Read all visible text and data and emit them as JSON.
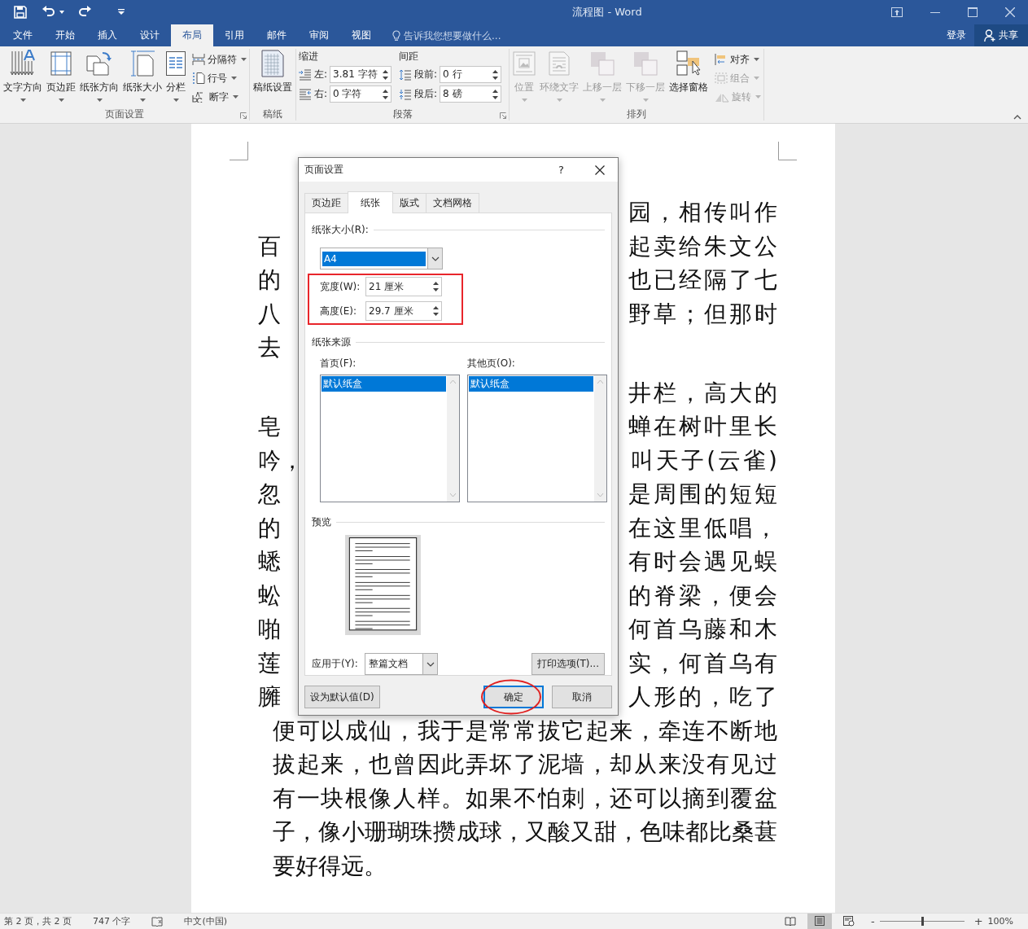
{
  "title_bar": {
    "title": "流程图 - Word"
  },
  "ribbon_tabs": [
    {
      "label": "文件",
      "selected": false
    },
    {
      "label": "开始",
      "selected": false
    },
    {
      "label": "插入",
      "selected": false
    },
    {
      "label": "设计",
      "selected": false
    },
    {
      "label": "布局",
      "selected": true
    },
    {
      "label": "引用",
      "selected": false
    },
    {
      "label": "邮件",
      "selected": false
    },
    {
      "label": "审阅",
      "selected": false
    },
    {
      "label": "视图",
      "selected": false
    }
  ],
  "tell_me": {
    "placeholder": "告诉我您想要做什么..."
  },
  "account": {
    "sign_in": "登录",
    "share": "共享"
  },
  "ribbon_groups": [
    {
      "kind": "page_setup",
      "label": "页面设置",
      "launcher": true,
      "large": [
        {
          "label": [
            "文字方向"
          ],
          "dropdown": true,
          "disabled": false
        },
        {
          "label": [
            "页边距"
          ],
          "dropdown": true,
          "disabled": false
        },
        {
          "label": [
            "纸张方向"
          ],
          "dropdown": true,
          "disabled": false
        },
        {
          "label": [
            "纸张大小"
          ],
          "dropdown": true,
          "disabled": false
        },
        {
          "label": [
            "分栏"
          ],
          "dropdown": true,
          "disabled": false
        }
      ],
      "small": [
        {
          "label": "分隔符",
          "dropdown": true,
          "disabled": false
        },
        {
          "label": "行号",
          "dropdown": true,
          "disabled": false
        },
        {
          "label": "断字",
          "dropdown": true,
          "disabled": false
        }
      ]
    },
    {
      "kind": "manuscript",
      "label": "稿纸",
      "launcher": false,
      "large": [
        {
          "label": [
            "稿纸",
            "设置"
          ],
          "dropdown": false,
          "disabled": false
        }
      ]
    },
    {
      "kind": "paragraph",
      "label": "段落",
      "launcher": true,
      "columns": [
        {
          "heading": "缩进",
          "fields": [
            {
              "label": "左:",
              "value": "3.81 字符"
            },
            {
              "label": "右:",
              "value": "0 字符"
            }
          ]
        },
        {
          "heading": "间距",
          "fields": [
            {
              "label": "段前:",
              "value": "0 行"
            },
            {
              "label": "段后:",
              "value": "8 磅"
            }
          ]
        }
      ]
    },
    {
      "kind": "arrange",
      "label": "排列",
      "launcher": false,
      "large": [
        {
          "label": [
            "位置"
          ],
          "dropdown": true,
          "disabled": true
        },
        {
          "label": [
            "环绕文字"
          ],
          "dropdown": true,
          "disabled": true
        },
        {
          "label": [
            "上移一层"
          ],
          "dropdown": true,
          "disabled": true
        },
        {
          "label": [
            "下移一层"
          ],
          "dropdown": true,
          "disabled": true
        },
        {
          "label": [
            "选择窗格"
          ],
          "dropdown": false,
          "disabled": false
        }
      ],
      "small": [
        {
          "label": "对齐",
          "dropdown": true,
          "disabled": false
        },
        {
          "label": "组合",
          "dropdown": true,
          "disabled": true
        },
        {
          "label": "旋转",
          "dropdown": true,
          "disabled": true
        }
      ]
    }
  ],
  "document": {
    "paragraphs": [
      {
        "lines": [
          {
            "kind": "split",
            "right": "园，相传叫作"
          },
          {
            "kind": "split",
            "left": "百",
            "right": "起卖给朱文公"
          },
          {
            "kind": "split",
            "left": "的",
            "right": "也已经隔了七"
          },
          {
            "kind": "split",
            "left": "八",
            "right": "野草；但那时"
          },
          {
            "kind": "split",
            "left": "去"
          }
        ]
      },
      {
        "lines": [
          {
            "kind": "split",
            "right": "井栏，高大的"
          },
          {
            "kind": "split",
            "left": "皂",
            "right": "蝉在树叶里长"
          },
          {
            "kind": "split",
            "left": "吟，",
            "right": "叫天子(云雀)"
          },
          {
            "kind": "split",
            "left": "忽",
            "right": "是周围的短短"
          },
          {
            "kind": "split",
            "left": "的",
            "right": "在这里低唱，"
          },
          {
            "kind": "split",
            "left": "蟋",
            "right": "有时会遇见蜈"
          },
          {
            "kind": "split",
            "left": "蚣",
            "right": "的脊梁，便会"
          },
          {
            "kind": "split",
            "left": "啪",
            "right": "何首乌藤和木"
          },
          {
            "kind": "split",
            "left": "莲",
            "right": "实，何首乌有"
          },
          {
            "kind": "split",
            "left": "臃",
            "right": "人形的，吃了"
          },
          {
            "kind": "full",
            "text": "便可以成仙，我于是常常拔它起来，牵连不断地"
          },
          {
            "kind": "full",
            "text": "拔起来，也曾因此弄坏了泥墙，却从来没有见过"
          },
          {
            "kind": "full",
            "text": "有一块根像人样。如果不怕刺，还可以摘到覆盆"
          },
          {
            "kind": "full",
            "text": "子，像小珊瑚珠攒成球，又酸又甜，色味都比桑葚"
          },
          {
            "kind": "full",
            "text": "要好得远。"
          }
        ]
      }
    ]
  },
  "dialog": {
    "title": "页面设置",
    "help": "?",
    "tabs": [
      {
        "label": "页边距",
        "selected": false
      },
      {
        "label": "纸张",
        "selected": true
      },
      {
        "label": "版式",
        "selected": false
      },
      {
        "label": "文档网格",
        "selected": false
      }
    ],
    "paper_size": {
      "heading": "纸张大小(R):",
      "value": "A4",
      "fields": [
        {
          "label": "宽度(W):",
          "value": "21 厘米"
        },
        {
          "label": "高度(E):",
          "value": "29.7 厘米"
        }
      ]
    },
    "paper_source": {
      "heading": "纸张来源",
      "lists": [
        {
          "label": "首页(F):",
          "items": [
            {
              "text": "默认纸盒",
              "selected": true
            }
          ]
        },
        {
          "label": "其他页(O):",
          "items": [
            {
              "text": "默认纸盒",
              "selected": true
            }
          ]
        }
      ]
    },
    "preview": {
      "heading": "预览"
    },
    "apply_to": {
      "label": "应用于(Y):",
      "value": "整篇文档"
    },
    "print_options": "打印选项(T)...",
    "footer_buttons": [
      {
        "label": "设为默认值(D)",
        "default": false
      },
      {
        "label": "确定",
        "default": true
      },
      {
        "label": "取消",
        "default": false
      }
    ]
  },
  "status_bar": {
    "page": "第 2 页，共 2 页",
    "words": "747 个字",
    "language": "中文(中国)",
    "views": [
      {
        "selected": false
      },
      {
        "selected": true
      },
      {
        "selected": false
      }
    ],
    "zoom": {
      "minus": "-",
      "plus": "+",
      "level": 0.5,
      "reading": "100%"
    }
  }
}
